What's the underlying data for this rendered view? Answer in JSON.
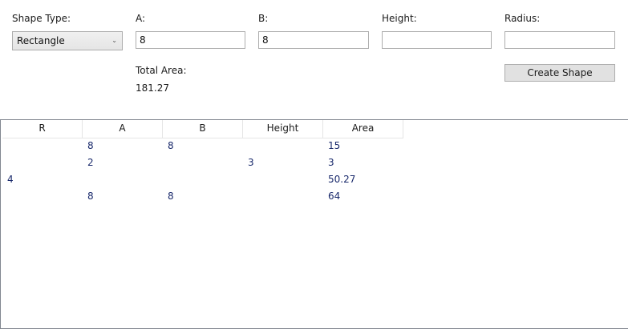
{
  "form": {
    "shape_type_label": "Shape Type:",
    "shape_type_value": "Rectangle",
    "a_label": "A:",
    "a_value": "8",
    "b_label": "B:",
    "b_value": "8",
    "height_label": "Height:",
    "height_value": "",
    "radius_label": "Radius:",
    "radius_value": "",
    "total_area_label": "Total Area:",
    "total_area_value": "181.27",
    "create_button": "Create Shape"
  },
  "table": {
    "columns": [
      "R",
      "A",
      "B",
      "Height",
      "Area"
    ],
    "rows": [
      [
        "",
        "8",
        "8",
        "",
        "15"
      ],
      [
        "",
        "2",
        "",
        "3",
        "3"
      ],
      [
        "4",
        "",
        "",
        "",
        "50.27"
      ],
      [
        "",
        "8",
        "8",
        "",
        "64"
      ]
    ]
  }
}
